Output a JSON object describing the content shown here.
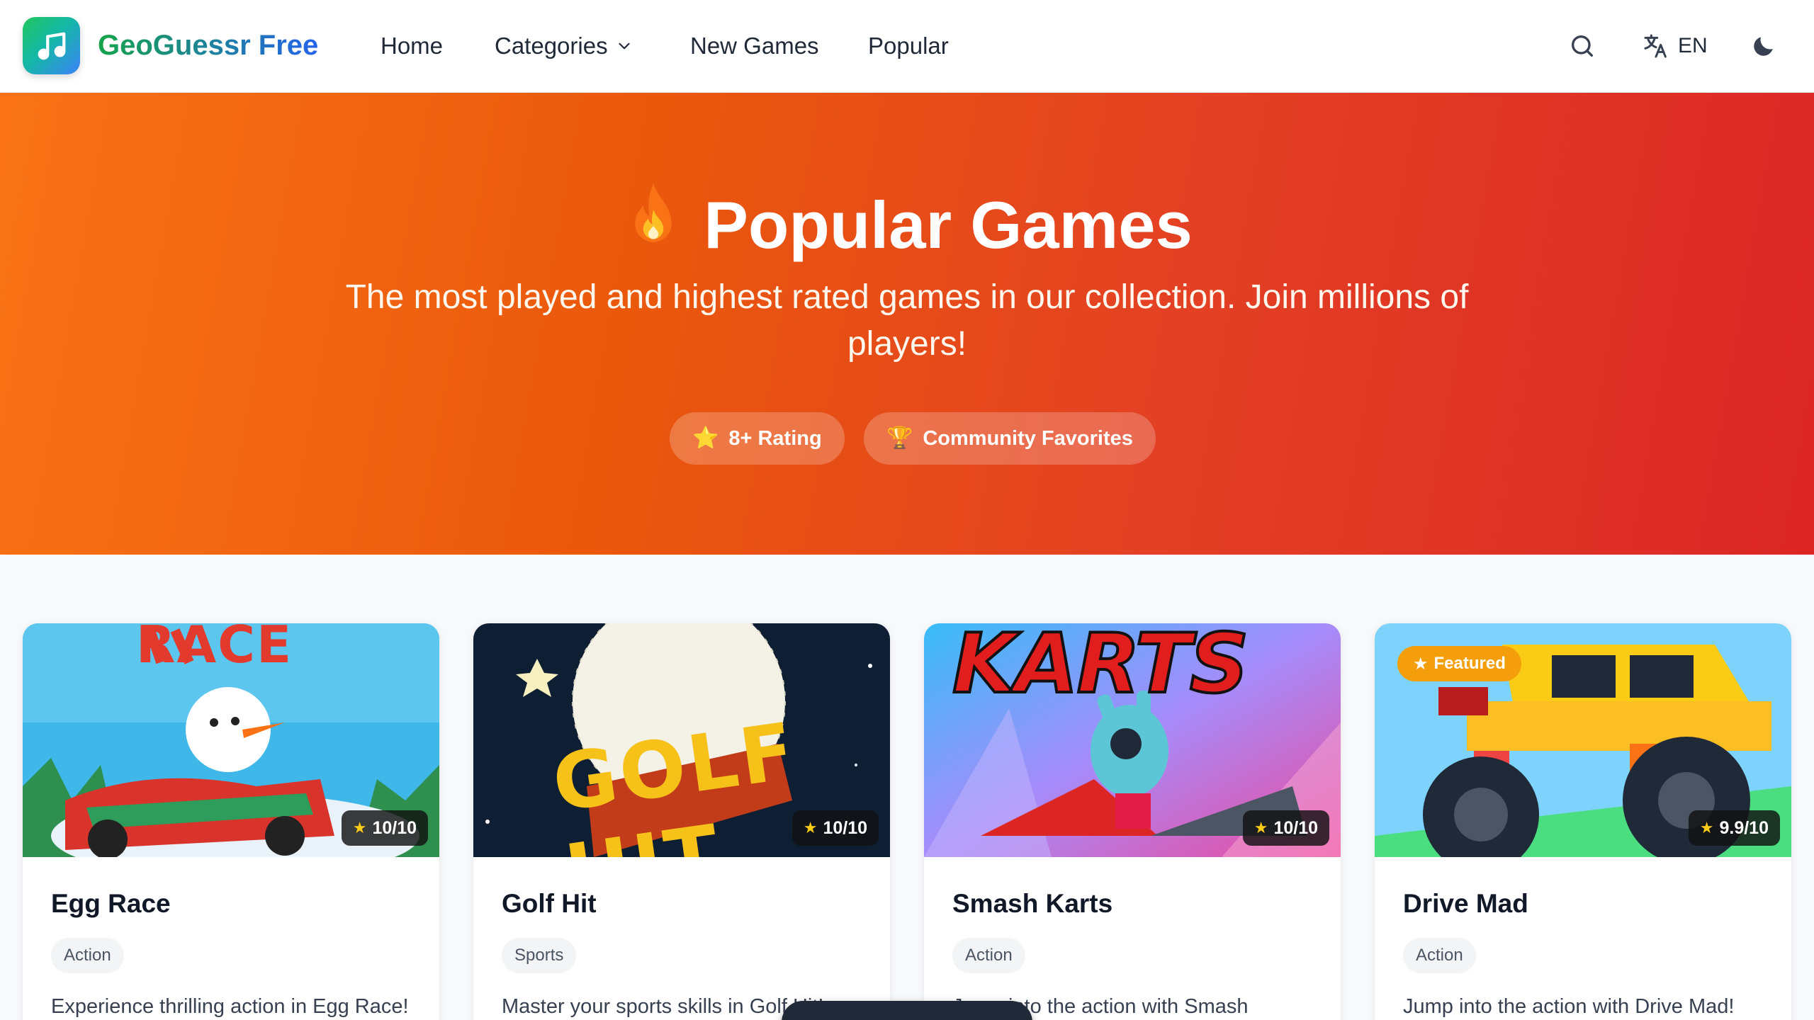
{
  "header": {
    "brand": "GeoGuessr Free",
    "nav": {
      "home": "Home",
      "categories": "Categories",
      "new_games": "New Games",
      "popular": "Popular"
    },
    "language": "EN",
    "icons": [
      "music-note-icon",
      "chevron-down-icon",
      "search-icon",
      "translate-icon",
      "moon-icon"
    ]
  },
  "hero": {
    "title": "Popular Games",
    "subtitle": "The most played and highest rated games in our collection. Join millions of players!",
    "badges": [
      {
        "icon": "⭐",
        "label": "8+ Rating"
      },
      {
        "icon": "🏆",
        "label": "Community Favorites"
      }
    ],
    "colors": {
      "start": "#f97316",
      "end": "#dc2626"
    }
  },
  "games": [
    {
      "title": "Egg Race",
      "category": "Action",
      "rating": "10/10",
      "description": "Experience thrilling action in Egg Race!",
      "thumb_text": "RACE"
    },
    {
      "title": "Golf Hit",
      "category": "Sports",
      "rating": "10/10",
      "description": "Master your sports skills in Golf Hit!",
      "thumb_text": "GOLF HIT"
    },
    {
      "title": "Smash Karts",
      "category": "Action",
      "rating": "10/10",
      "description": "Jump into the action with Smash",
      "thumb_text": "KARTS"
    },
    {
      "title": "Drive Mad",
      "category": "Action",
      "rating": "9.9/10",
      "description": "Jump into the action with Drive Mad!",
      "badge": "Featured"
    }
  ]
}
